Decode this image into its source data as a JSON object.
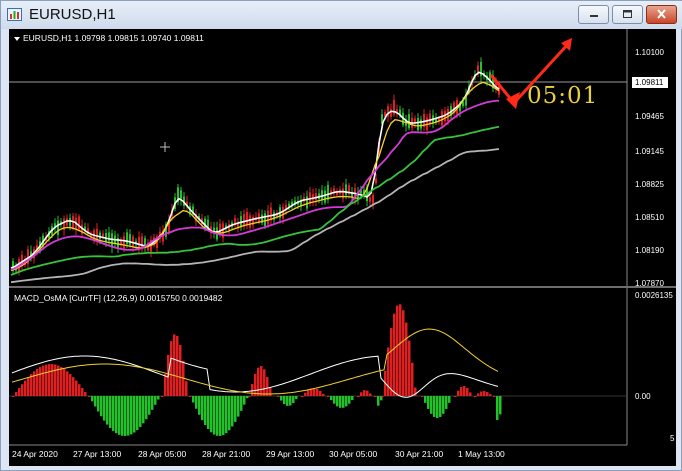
{
  "window": {
    "title": "EURUSD,H1",
    "controls": [
      "minimize-button",
      "restore-button",
      "close-button"
    ]
  },
  "chart": {
    "header": "EURUSD,H1  1.09798 1.09815 1.09740 1.09811",
    "price_labels": [
      "1.10100",
      "1.09465",
      "1.09145",
      "1.08825",
      "1.08510",
      "1.08190",
      "1.07870"
    ],
    "current_price": "1.09811",
    "timer": "05:01",
    "colors": {
      "background": "#000000",
      "bull_candle": "#22c22a",
      "bear_candle": "#e02020",
      "ma_white": "#ffffff",
      "ma_yellow": "#f2d22e",
      "ma_magenta": "#d43ad8",
      "ma_green": "#35c43a",
      "ma_gray": "#b4b4b4",
      "arrow": "#ff2a18"
    }
  },
  "macd": {
    "header": "MACD_OsMA [CurrTF] (12,26,9) 0.0015750 0.0019482",
    "labels": [
      "0.0026135",
      "0.00",
      "5"
    ]
  },
  "time_axis": [
    "24 Apr 2020",
    "27 Apr 13:00",
    "28 Apr 05:00",
    "28 Apr 21:00",
    "29 Apr 13:00",
    "30 Apr 05:00",
    "30 Apr 21:00",
    "1 May 13:00"
  ]
}
